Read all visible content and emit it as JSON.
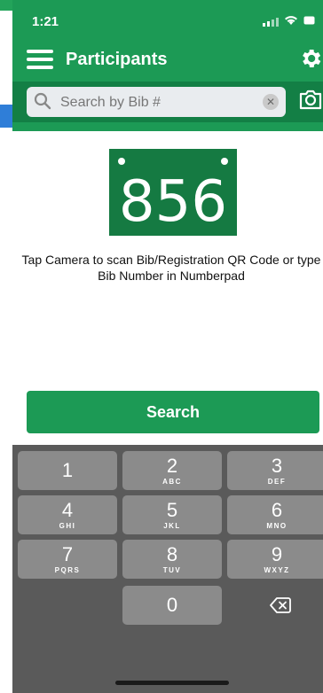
{
  "status_bar": {
    "time": "1:21"
  },
  "nav": {
    "title": "Participants"
  },
  "search": {
    "placeholder": "Search by Bib #",
    "value": ""
  },
  "bib": {
    "number": "856"
  },
  "instructions": "Tap Camera to scan Bib/Registration QR Code or type Bib Number in Numberpad",
  "search_button_label": "Search",
  "keypad": {
    "keys": [
      {
        "digit": "1",
        "letters": ""
      },
      {
        "digit": "2",
        "letters": "ABC"
      },
      {
        "digit": "3",
        "letters": "DEF"
      },
      {
        "digit": "4",
        "letters": "GHI"
      },
      {
        "digit": "5",
        "letters": "JKL"
      },
      {
        "digit": "6",
        "letters": "MNO"
      },
      {
        "digit": "7",
        "letters": "PQRS"
      },
      {
        "digit": "8",
        "letters": "TUV"
      },
      {
        "digit": "9",
        "letters": "WXYZ"
      },
      {
        "digit": "0",
        "letters": ""
      }
    ]
  },
  "colors": {
    "header_green": "#1c9a55",
    "search_row_green": "#137f45",
    "bib_green": "#157a42",
    "keyboard_bg": "#5a5a5a",
    "key_bg": "#8b8b8b"
  },
  "icons": [
    "menu-icon",
    "gear-icon",
    "search-icon",
    "clear-icon",
    "camera-icon",
    "delete-icon",
    "signal-icon",
    "wifi-icon",
    "battery-icon"
  ]
}
